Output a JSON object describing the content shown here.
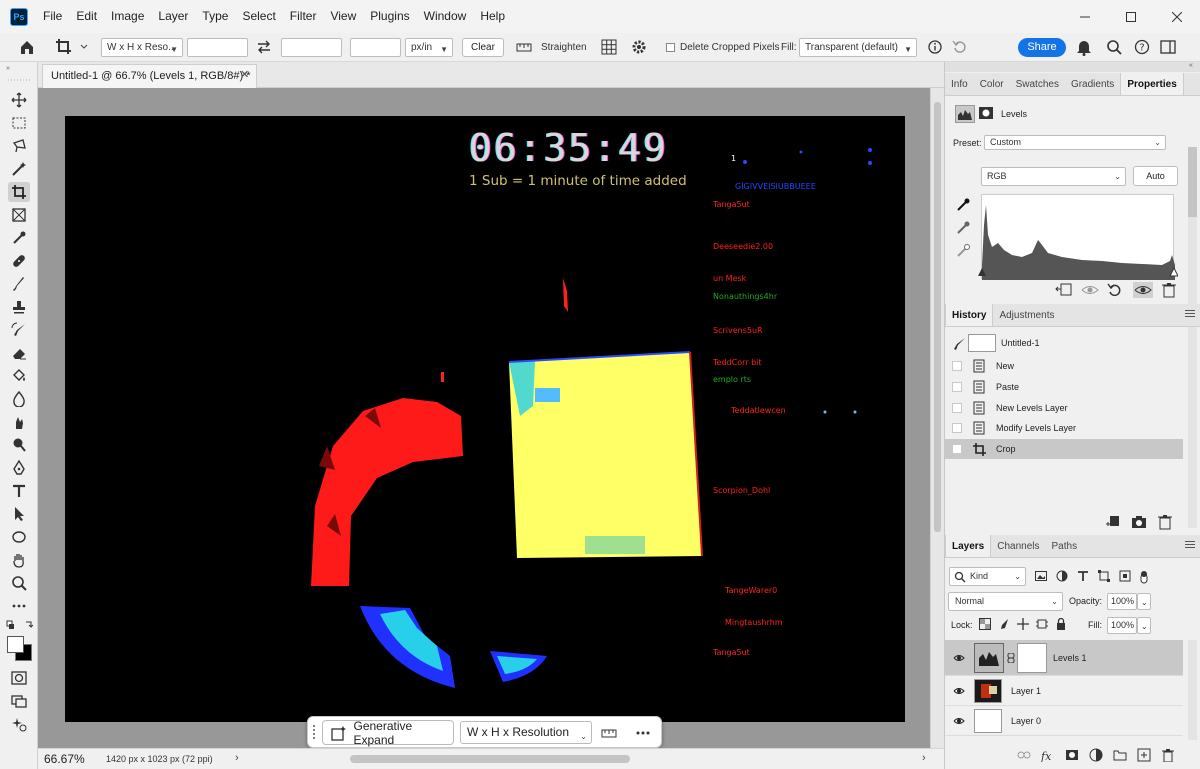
{
  "app": {
    "logo": "Ps",
    "menu": [
      "File",
      "Edit",
      "Image",
      "Layer",
      "Type",
      "Select",
      "Filter",
      "View",
      "Plugins",
      "Window",
      "Help"
    ]
  },
  "options": {
    "ratio_preset": "W x H x Reso...",
    "width_value": "",
    "height_value": "",
    "resolution_value": "",
    "resolution_unit": "px/in",
    "clear_label": "Clear",
    "straighten_label": "Straighten",
    "delete_cropped_label": "Delete Cropped Pixels",
    "fill_label": "Fill:",
    "fill_value": "Transparent (default)",
    "share_label": "Share"
  },
  "document": {
    "tab_title": "Untitled-1 @ 66.7% (Levels 1, RGB/8#) *",
    "timer": "06:35:49",
    "subtitle": "1 Sub = 1 minute of time added",
    "chat_lines": [
      {
        "text": "1",
        "color": "#ffffff"
      },
      {
        "text": "GIGIVVEISIUBBUEEE",
        "color": "#2244ff"
      },
      {
        "text": "Tanga5ut",
        "color": "#ff2222"
      },
      {
        "text": "Deeseedie2.00",
        "color": "#ff2222"
      },
      {
        "text": "un Mesk",
        "color": "#ff2222"
      },
      {
        "text": "Nonauthings4hr",
        "color": "#22aa22"
      },
      {
        "text": "Scrivens5uR",
        "color": "#ff2222"
      },
      {
        "text": "TeddCorr bit",
        "color": "#ff2222"
      },
      {
        "text": "emplo rts",
        "color": "#22aa22"
      },
      {
        "text": "Teddatlewcen",
        "color": "#ff2222"
      },
      {
        "text": "Scorpion_Dohl",
        "color": "#ff2222"
      },
      {
        "text": "TangeWarer0",
        "color": "#ff2222"
      },
      {
        "text": "Mingtaushrhm",
        "color": "#ff2222"
      },
      {
        "text": "Tanga5ut",
        "color": "#ff2222"
      }
    ]
  },
  "status": {
    "zoom": "66.67%",
    "doc_info": "1420 px x 1023 px (72 ppi)"
  },
  "taskbar": {
    "generative_expand": "Generative Expand",
    "preset": "W x H x Resolution"
  },
  "properties": {
    "tabs": [
      "Info",
      "Color",
      "Swatches",
      "Gradients",
      "Properties"
    ],
    "active_tab": "Properties",
    "title": "Levels",
    "preset_label": "Preset:",
    "preset_value": "Custom",
    "channel": "RGB",
    "auto_label": "Auto"
  },
  "history": {
    "tabs": [
      "History",
      "Adjustments"
    ],
    "snapshot": "Untitled-1",
    "items": [
      "New",
      "Paste",
      "New Levels Layer",
      "Modify Levels Layer",
      "Crop"
    ],
    "selected_index": 4
  },
  "layers": {
    "tabs": [
      "Layers",
      "Channels",
      "Paths"
    ],
    "filter_kind": "Kind",
    "blend_mode": "Normal",
    "opacity_label": "Opacity:",
    "opacity_value": "100%",
    "lock_label": "Lock:",
    "fill_label": "Fill:",
    "fill_value": "100%",
    "items": [
      {
        "name": "Levels 1",
        "selected": true
      },
      {
        "name": "Layer 1",
        "selected": false
      },
      {
        "name": "Layer 0",
        "selected": false
      }
    ]
  },
  "colors": {
    "accent": "#1473e6",
    "canvas_bg": "#989898",
    "timer_color": "#cfcfcf",
    "highlight_yellow": "#ffff66",
    "highlight_red": "#ff1a1a"
  }
}
